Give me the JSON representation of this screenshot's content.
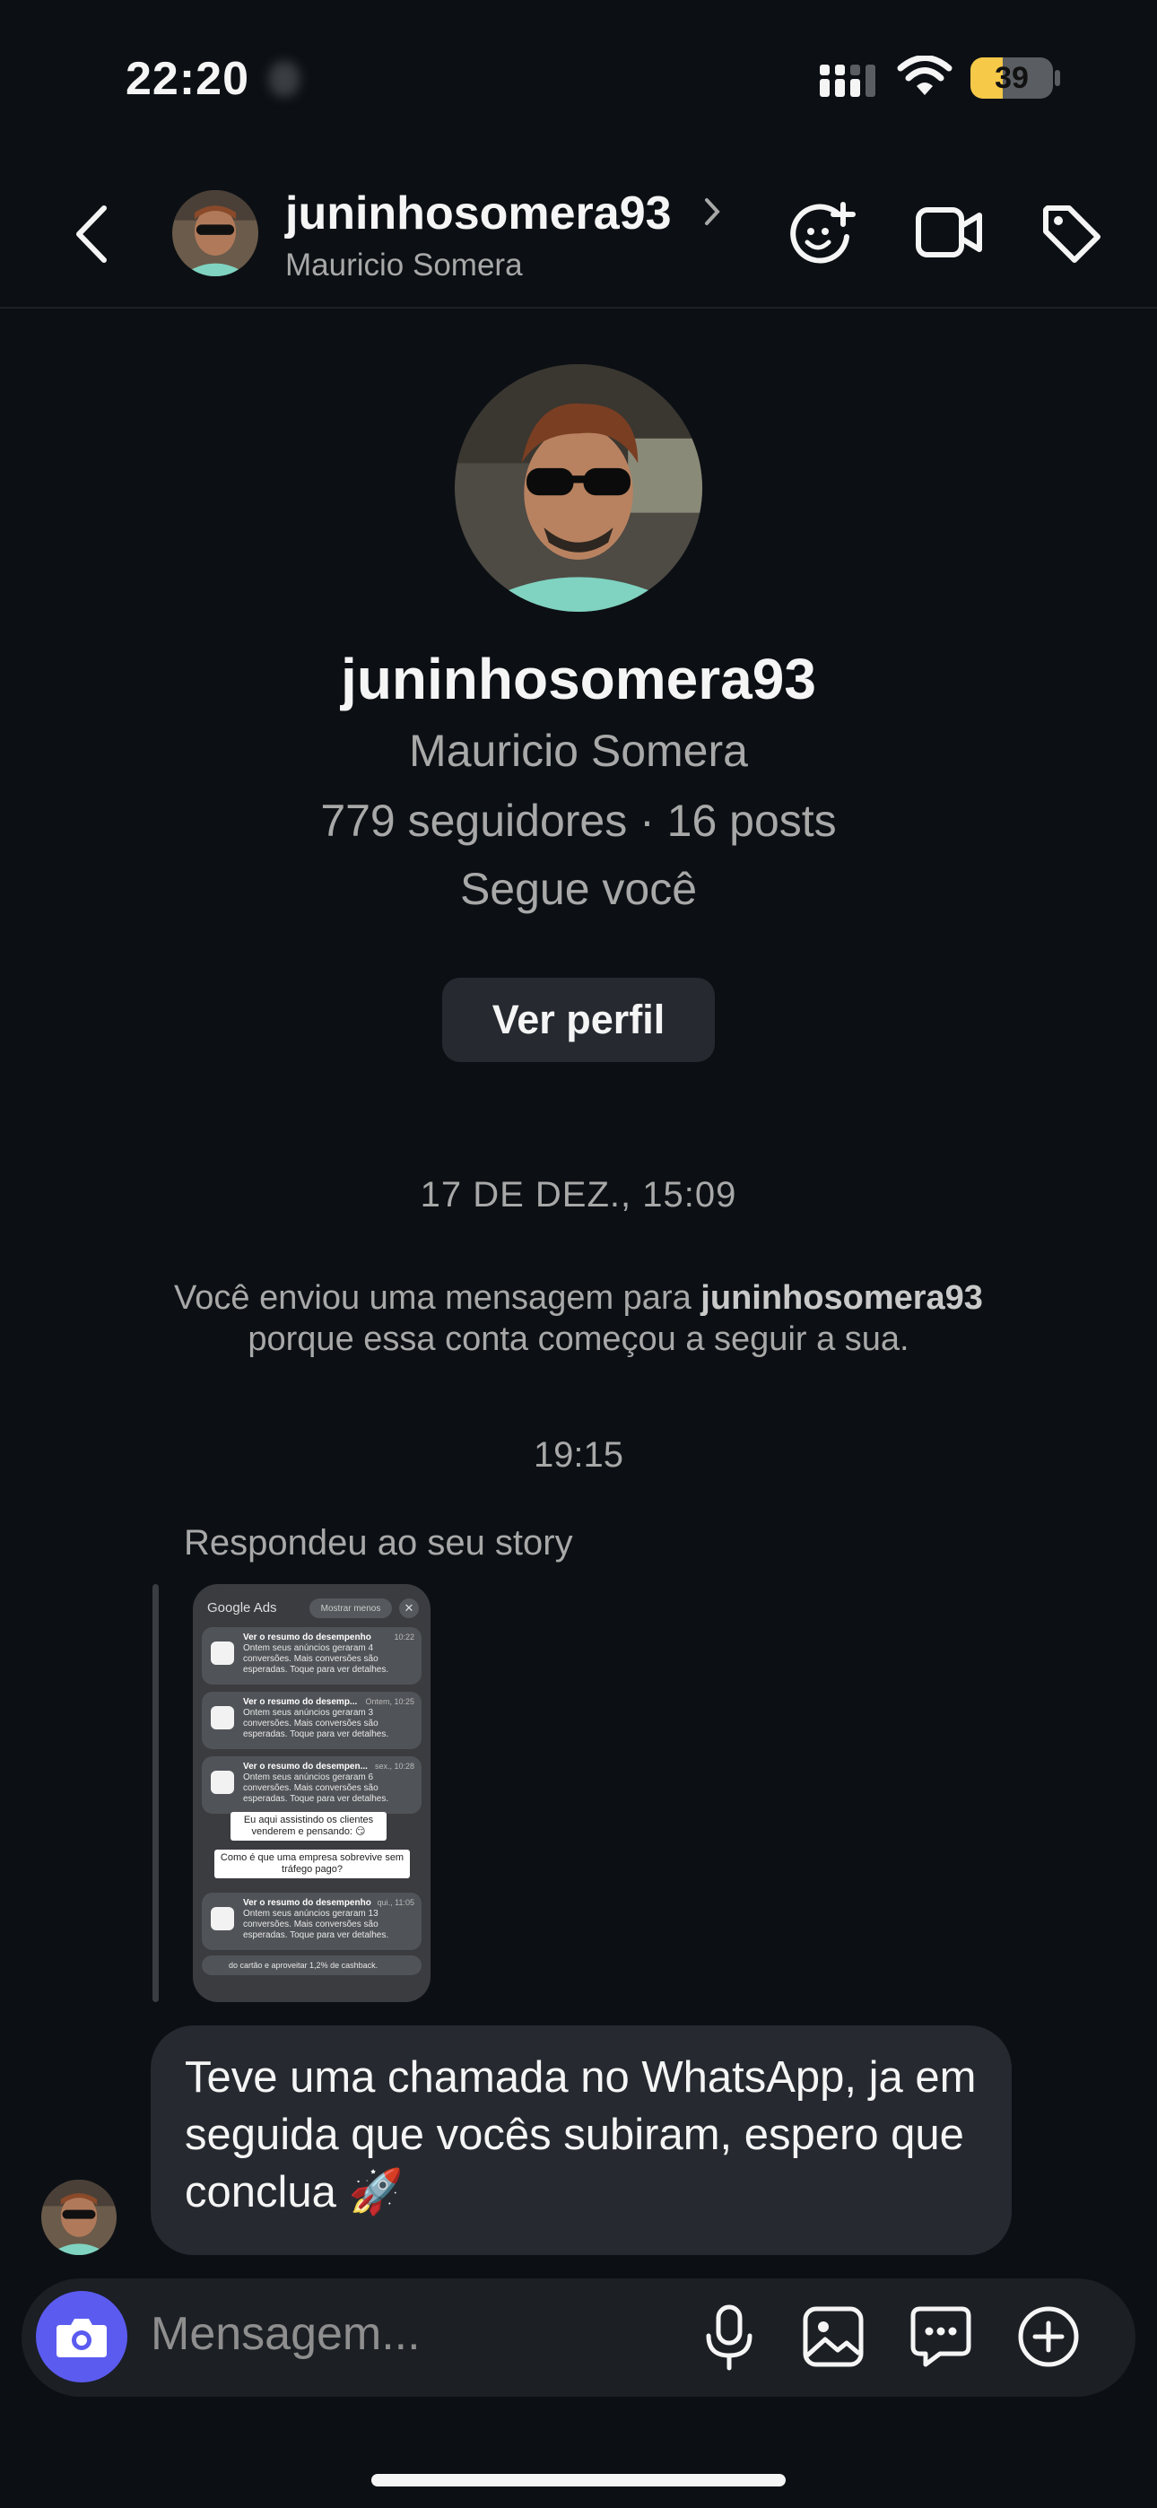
{
  "status_bar": {
    "time": "22:20",
    "battery": "39",
    "battery_level_percent": 39
  },
  "header": {
    "username": "juninhosomera93",
    "name": "Mauricio Somera"
  },
  "profile": {
    "username": "juninhosomera93",
    "name": "Mauricio Somera",
    "stats": "779 seguidores · 16 posts",
    "follow_status": "Segue você",
    "view_profile_label": "Ver perfil"
  },
  "thread": {
    "date_separator": "17 DE DEZ., 15:09",
    "system_message_prefix": "Você enviou uma mensagem para ",
    "system_message_user": "juninhosomera93",
    "system_message_suffix": "porque essa conta começou a seguir a sua.",
    "time_separator": "19:15",
    "reply_label": "Respondeu ao seu story",
    "story": {
      "app_name": "Google Ads",
      "show_less": "Mostrar menos",
      "notifications": [
        {
          "title": "Ver o resumo do desempenho",
          "time": "10:22",
          "body": "Ontem seus anúncios geraram 4 conversões. Mais conversões são esperadas. Toque para ver detalhes."
        },
        {
          "title": "Ver o resumo do desemp...",
          "time": "Ontem, 10:25",
          "body": "Ontem seus anúncios geraram 3 conversões. Mais conversões são esperadas. Toque para ver detalhes."
        },
        {
          "title": "Ver o resumo do desempen...",
          "time": "sex., 10:28",
          "body": "Ontem seus anúncios geraram 6 conversões. Mais conversões são esperadas. Toque para ver detalhes."
        },
        {
          "title": "Ver o resumo do desempenho",
          "time": "qui., 11:05",
          "body": "Ontem seus anúncios geraram 13 conversões. Mais conversões são esperadas. Toque para ver detalhes."
        }
      ],
      "sticker_1": "Eu aqui assistindo os clientes venderem e pensando: 😏",
      "sticker_2": "Como é que uma empresa sobrevive sem tráfego pago?",
      "footer_text": "do cartão e aproveitar 1,2% de cashback."
    },
    "message": "Teve uma chamada no WhatsApp, ja em seguida que vocês subiram, espero que conclua 🚀"
  },
  "composer": {
    "placeholder": "Mensagem..."
  },
  "icons": {
    "back": "chevron-left-icon",
    "header_chevron": "chevron-right-icon",
    "effects": "sticker-face-add-icon",
    "video": "video-camera-icon",
    "tag": "tag-icon",
    "camera": "camera-icon",
    "mic": "microphone-icon",
    "gallery": "image-icon",
    "sticker": "chat-sticker-icon",
    "add": "plus-circle-icon"
  },
  "colors": {
    "background": "#0c1014",
    "bubble": "#262a30",
    "camera_button": "#5b5bf0",
    "battery": "#f7c948"
  }
}
